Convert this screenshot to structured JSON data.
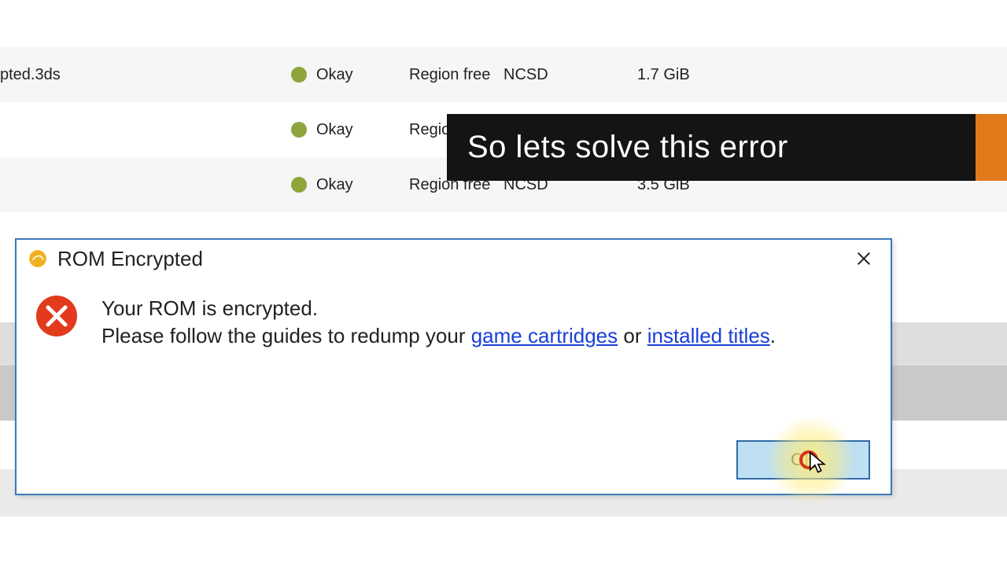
{
  "table": {
    "rows": [
      {
        "filename": "pted.3ds",
        "status": "Okay",
        "region": "Region free",
        "format": "NCSD",
        "size": "1.7 GiB"
      },
      {
        "filename": "",
        "status": "Okay",
        "region": "Regio",
        "format": "",
        "size": ""
      },
      {
        "filename": "",
        "status": "Okay",
        "region": "Region free",
        "format": "NCSD",
        "size": "3.5 GiB"
      }
    ]
  },
  "caption": {
    "text": "So lets solve this error"
  },
  "dialog": {
    "title": "ROM Encrypted",
    "message_line1": "Your ROM is encrypted.",
    "message_prefix": "Please follow the guides to redump your ",
    "link1": "game cartridges",
    "message_middle": " or ",
    "link2": "installed titles",
    "message_suffix": ".",
    "ok_label": "OK"
  }
}
